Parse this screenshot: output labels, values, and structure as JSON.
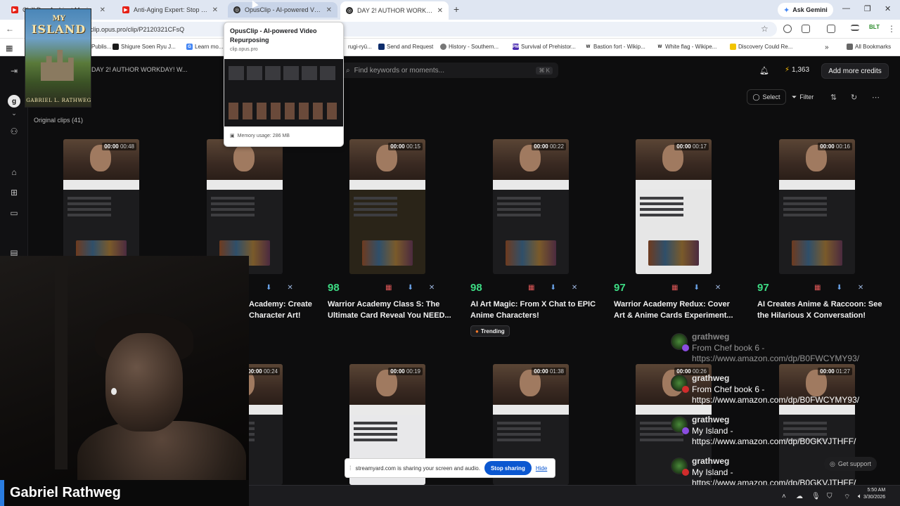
{
  "browser": {
    "tabs": [
      {
        "title": "Chill Dog Ambient Music",
        "icon": "youtube-icon"
      },
      {
        "title": "Anti-Aging Expert: Stop Touching",
        "icon": "youtube-icon"
      },
      {
        "title": "OpusClip - AI-powered Video Repurposing",
        "icon": "opusclip-icon"
      },
      {
        "title": "DAY 2! AUTHOR WORKDAY! Writing",
        "icon": "opusclip-icon"
      }
    ],
    "new_tab": "+",
    "ask_gemini": "Ask Gemini",
    "url": "clip.opus.pro/clip/P2120321CFsQ",
    "bookmarks": [
      {
        "label": "Publis...",
        "icon": ""
      },
      {
        "label": "Shigure Soen Ryu J...",
        "icon": ""
      },
      {
        "label": "Learn mo...",
        "icon": "G"
      },
      {
        "label": "rugi-ryū...",
        "icon": ""
      },
      {
        "label": "Send and Request",
        "icon": ""
      },
      {
        "label": "History - Southern...",
        "icon": ""
      },
      {
        "label": "Survival of Prehistor...",
        "icon": "PM"
      },
      {
        "label": "Bastion fort - Wikip...",
        "icon": "W"
      },
      {
        "label": "White flag - Wikipe...",
        "icon": "W"
      },
      {
        "label": "Discovery Could Re...",
        "icon": ""
      }
    ],
    "all_bookmarks": "All Bookmarks"
  },
  "hovercard": {
    "title": "OpusClip - AI-powered Video Repurposing",
    "url": "clip.opus.pro",
    "memory": "Memory usage: 286 MB"
  },
  "book": {
    "title_line1": "MY",
    "title_line2": "ISLAND",
    "author": "GABRIEL L. RATHWEG"
  },
  "app": {
    "project_title": "DAY 2! AUTHOR WORKDAY! W...",
    "avatar_letter": "g",
    "search_placeholder": "Find keywords or moments...",
    "search_shortcut": "⌘ K",
    "credits": "1,363",
    "add_credits": "Add more credits",
    "select": "Select",
    "filter": "Filter",
    "original_clips": "Original clips  (41)"
  },
  "clips_row1": [
    {
      "elapsed": "00:00",
      "total": "00:48",
      "score": "",
      "title": ""
    },
    {
      "elapsed": "",
      "total": "",
      "score": "",
      "title": "Academy: Create Character Art!"
    },
    {
      "elapsed": "00:00",
      "total": "00:15",
      "score": "98",
      "title": "Warrior Academy Class S: The Ultimate Card Reveal You NEED..."
    },
    {
      "elapsed": "00:00",
      "total": "00:22",
      "score": "98",
      "title": "AI Art Magic: From X Chat to EPIC Anime Characters!"
    },
    {
      "elapsed": "00:00",
      "total": "00:17",
      "score": "97",
      "title": "Warrior Academy Redux: Cover Art & Anime Cards Experiment..."
    },
    {
      "elapsed": "00:00",
      "total": "00:16",
      "score": "97",
      "title": "AI Creates Anime & Raccoon: See the Hilarious X Conversation!"
    }
  ],
  "clips_row2": [
    {
      "elapsed": "00:00",
      "total": "00:24"
    },
    {
      "elapsed": "00:00",
      "total": "00:19"
    },
    {
      "elapsed": "00:00",
      "total": "01:38"
    },
    {
      "elapsed": "00:00",
      "total": "00:26"
    },
    {
      "elapsed": "00:00",
      "total": "01:27"
    }
  ],
  "trending": "Trending",
  "chat": [
    {
      "user": "grathweg",
      "text": "From Chef book 6 - https://www.amazon.com/dp/B0FWCYMY93/"
    },
    {
      "user": "grathweg",
      "text": "From Chef book 6 - https://www.amazon.com/dp/B0FWCYMY93/"
    },
    {
      "user": "grathweg",
      "text": "My Island - https://www.amazon.com/dp/B0GKVJTHFF/"
    },
    {
      "user": "grathweg",
      "text": "My Island - https://www.amazon.com/dp/B0GKVJTHFF/"
    }
  ],
  "share": {
    "message": "streamyard.com is sharing your screen and audio.",
    "stop": "Stop sharing",
    "hide": "Hide"
  },
  "get_support": "Get support",
  "webcam_name": "Gabriel Rathweg",
  "clock": {
    "time": "5:50 AM",
    "date": "3/30/2026"
  },
  "colors": {
    "accent_blue": "#2a7de1",
    "score_green": "#3ddc84",
    "chrome_tab": "#dfe6f2",
    "share_blue": "#0b57d0"
  }
}
